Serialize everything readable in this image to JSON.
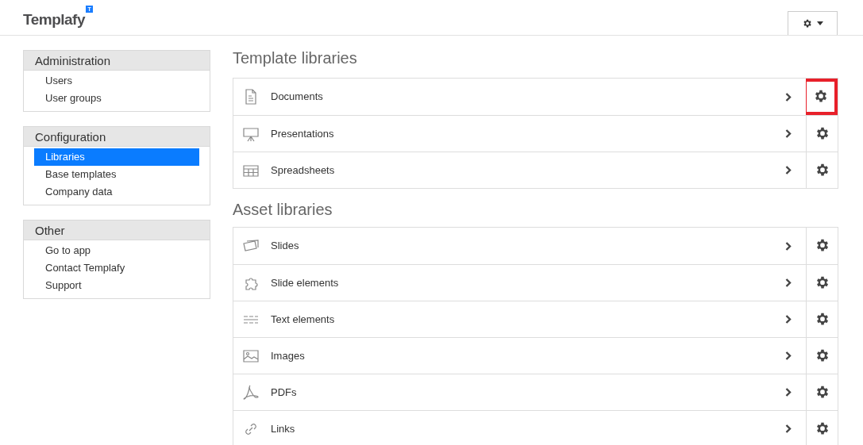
{
  "header": {
    "logo": "Templafy",
    "logo_badge": "T"
  },
  "sidebar": [
    {
      "title": "Administration",
      "items": [
        {
          "label": "Users",
          "selected": false
        },
        {
          "label": "User groups",
          "selected": false
        }
      ]
    },
    {
      "title": "Configuration",
      "items": [
        {
          "label": "Libraries",
          "selected": true
        },
        {
          "label": "Base templates",
          "selected": false
        },
        {
          "label": "Company data",
          "selected": false
        }
      ]
    },
    {
      "title": "Other",
      "items": [
        {
          "label": "Go to app",
          "selected": false
        },
        {
          "label": "Contact Templafy",
          "selected": false
        },
        {
          "label": "Support",
          "selected": false
        }
      ]
    }
  ],
  "sections": [
    {
      "title": "Template libraries",
      "rows": [
        {
          "label": "Documents",
          "highlighted": true
        },
        {
          "label": "Presentations",
          "highlighted": false
        },
        {
          "label": "Spreadsheets",
          "highlighted": false
        }
      ]
    },
    {
      "title": "Asset libraries",
      "rows": [
        {
          "label": "Slides",
          "highlighted": false
        },
        {
          "label": "Slide elements",
          "highlighted": false
        },
        {
          "label": "Text elements",
          "highlighted": false
        },
        {
          "label": "Images",
          "highlighted": false
        },
        {
          "label": "PDFs",
          "highlighted": false
        },
        {
          "label": "Links",
          "highlighted": false
        }
      ]
    }
  ]
}
